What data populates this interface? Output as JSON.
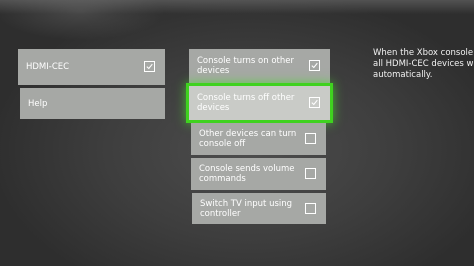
{
  "sidebar": {
    "items": [
      {
        "label": "HDMI-CEC",
        "checked": true,
        "icon": "check-icon"
      },
      {
        "label": "Help"
      }
    ]
  },
  "options": [
    {
      "label": "Console turns on other\ndevices",
      "checked": true,
      "selected": false
    },
    {
      "label": "Console turns off other\ndevices",
      "checked": true,
      "selected": true
    },
    {
      "label": "Other devices can turn\nconsole off",
      "checked": false,
      "selected": false
    },
    {
      "label": "Console sends volume\ncommands",
      "checked": false,
      "selected": false
    },
    {
      "label": "Switch TV input using\ncontroller",
      "checked": false,
      "selected": false
    }
  ],
  "description": {
    "text": "When the Xbox console is t\nall HDMI-CEC devices will t\nautomatically."
  },
  "colors": {
    "tile": "#a6a8a5",
    "selected_tile": "#c9cbc7",
    "focus_outline": "#3fd21f",
    "background": "#3e3e3e"
  }
}
